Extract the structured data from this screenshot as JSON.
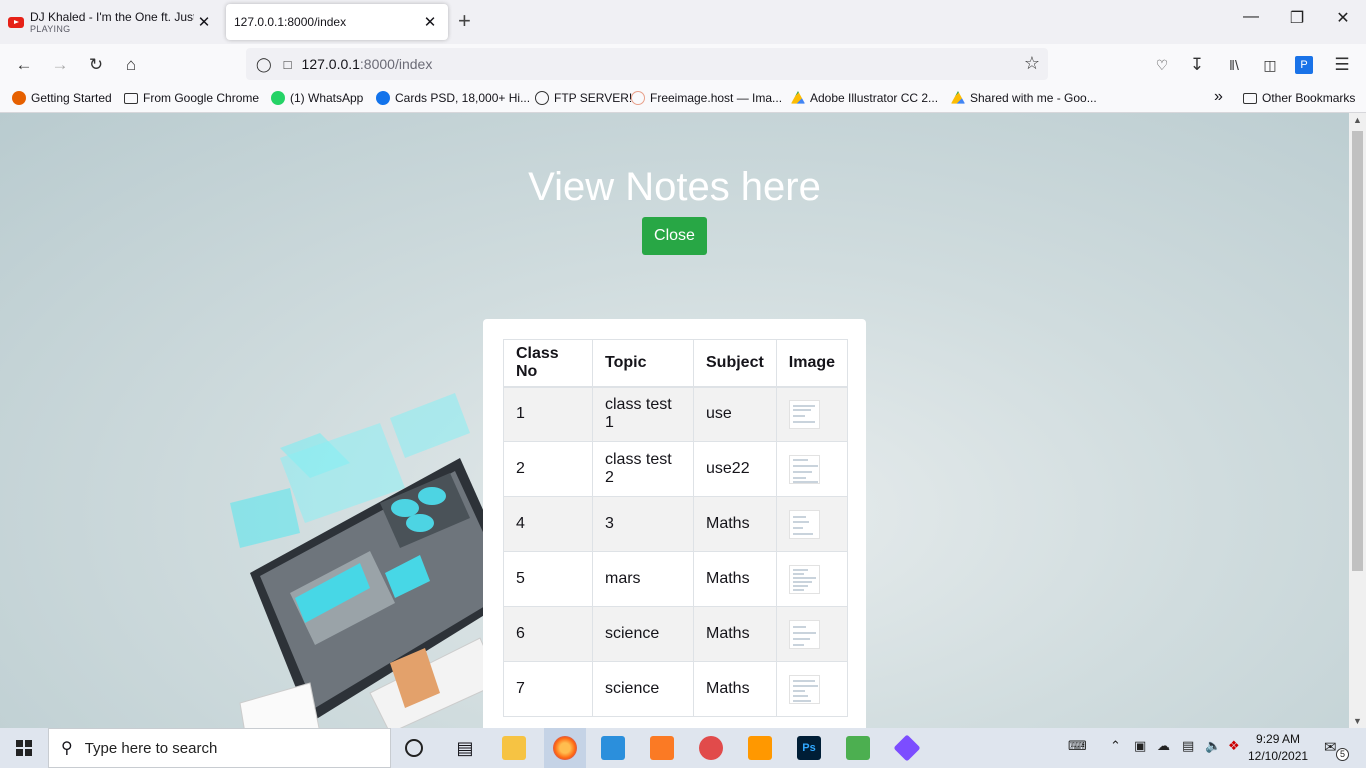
{
  "tabs": [
    {
      "title": "DJ Khaled - I'm the One ft. Justin",
      "subtitle": "PLAYING",
      "close": "✕"
    },
    {
      "title": "127.0.0.1:8000/index",
      "close": "✕"
    }
  ],
  "new_tab": "+",
  "window_controls": {
    "minimize": "—",
    "restore": "❐",
    "close": "✕"
  },
  "nav": {
    "back": "←",
    "forward": "→",
    "reload": "↻",
    "home": "⌂"
  },
  "url": {
    "host": "127.0.0.1",
    "path": ":8000/index"
  },
  "bookmarks": [
    {
      "label": "Getting Started",
      "icon": "firefox-icon",
      "color": "#e66000"
    },
    {
      "label": "From Google Chrome",
      "icon": "folder-icon",
      "color": "#333333"
    },
    {
      "label": "(1) WhatsApp",
      "icon": "whatsapp-icon",
      "color": "#25d366"
    },
    {
      "label": "Cards PSD, 18,000+ Hi...",
      "icon": "freepik-icon",
      "color": "#1273eb"
    },
    {
      "label": "FTP SERVER!",
      "icon": "globe-icon",
      "color": "#333333"
    },
    {
      "label": "Freeimage.host — Ima...",
      "icon": "freeimage-icon",
      "color": "#e8a08a"
    },
    {
      "label": "Adobe Illustrator CC 2...",
      "icon": "google-drive-icon",
      "color": "#fbbc04"
    },
    {
      "label": "Shared with me - Goo...",
      "icon": "google-drive-icon",
      "color": "#fbbc04"
    }
  ],
  "bookmarks_overflow": "»",
  "other_bookmarks": "Other Bookmarks",
  "page": {
    "heading": "View Notes here",
    "close_button": "Close",
    "table": {
      "headers": [
        "Class No",
        "Topic",
        "Subject",
        "Image"
      ],
      "rows": [
        [
          "1",
          "class test 1",
          "use"
        ],
        [
          "2",
          "class test 2",
          "use22"
        ],
        [
          "4",
          "3",
          "Maths"
        ],
        [
          "5",
          "mars",
          "Maths"
        ],
        [
          "6",
          "science",
          "Maths"
        ],
        [
          "7",
          "science",
          "Maths"
        ]
      ]
    }
  },
  "taskbar": {
    "search_placeholder": "Type here to search",
    "time": "9:29 AM",
    "date": "12/10/2021",
    "notifications": "5"
  },
  "colors": {
    "accent_green": "#28a745",
    "page_bg": "#c2d2d5"
  }
}
